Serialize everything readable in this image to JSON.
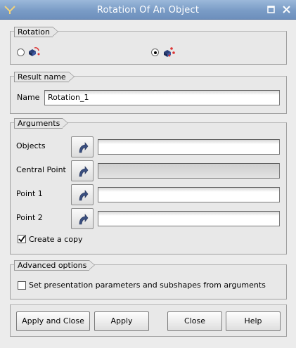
{
  "window": {
    "title": "Rotation Of An Object"
  },
  "rotation": {
    "frame_title": "Rotation",
    "options": [
      {
        "icon": "rotation-axis-angle-icon",
        "selected": false
      },
      {
        "icon": "rotation-three-points-icon",
        "selected": true
      }
    ]
  },
  "result": {
    "frame_title": "Result name",
    "name_label": "Name",
    "name_value": "Rotation_1"
  },
  "arguments": {
    "frame_title": "Arguments",
    "rows": [
      {
        "label": "Objects",
        "value": "",
        "enabled": true
      },
      {
        "label": "Central Point",
        "value": "",
        "enabled": false
      },
      {
        "label": "Point 1",
        "value": "",
        "enabled": true
      },
      {
        "label": "Point 2",
        "value": "",
        "enabled": true
      }
    ],
    "create_copy_label": "Create a copy",
    "create_copy_checked": true
  },
  "advanced": {
    "frame_title": "Advanced options",
    "set_params_label": "Set presentation parameters and subshapes from arguments",
    "set_params_checked": false
  },
  "buttons": {
    "apply_close": "Apply and Close",
    "apply": "Apply",
    "close": "Close",
    "help": "Help"
  },
  "colors": {
    "titlebar": "#7a9cc6",
    "background": "#ececec"
  }
}
